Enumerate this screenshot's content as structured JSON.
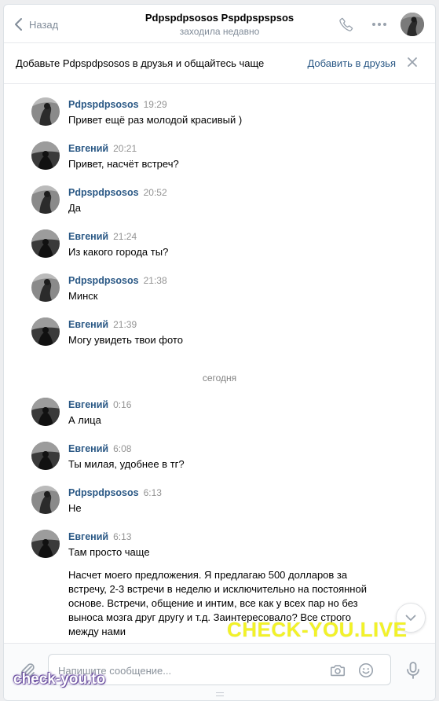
{
  "header": {
    "back_label": "Назад",
    "title": "Pdpspdpsosos Pspdpspspsos",
    "status": "заходила недавно"
  },
  "banner": {
    "text": "Добавьте Pdpspdpsosos в друзья и общайтесь чаще",
    "add_label": "Добавить в друзья"
  },
  "messages": [
    {
      "author": "Pdpspdpsosos",
      "time": "19:29",
      "text": "Привет ещё раз молодой красивый )"
    },
    {
      "author": "Евгений",
      "time": "20:21",
      "text": "Привет, насчёт встреч?"
    },
    {
      "author": "Pdpspdpsosos",
      "time": "20:52",
      "text": "Да"
    },
    {
      "author": "Евгений",
      "time": "21:24",
      "text": "Из какого города ты?"
    },
    {
      "author": "Pdpspdpsosos",
      "time": "21:38",
      "text": "Минск"
    },
    {
      "author": "Евгений",
      "time": "21:39",
      "text": "Могу увидеть твои фото"
    },
    {
      "author": "Евгений",
      "time": "0:16",
      "text": "А лица"
    },
    {
      "author": "Евгений",
      "time": "6:08",
      "text": "Ты милая, удобнее в тг?"
    },
    {
      "author": "Pdpspdpsosos",
      "time": "6:13",
      "text": "Не"
    },
    {
      "author": "Евгений",
      "time": "6:13",
      "text": "Там просто чаще",
      "extra": "Насчет моего предложения. Я предлагаю 500 долларов за встречу, 2-3 встречи в неделю и исключительно на постоянной основе. Встречи, общение и интим, все как у всех пар но без выноса мозга друг другу и т.д. Заинтересовало? Все строго между нами"
    }
  ],
  "date_separator": "сегодня",
  "composer": {
    "placeholder": "Напишите сообщение..."
  },
  "watermarks": {
    "main": "CHECK-YOU.LIVE",
    "corner": "check-you.to"
  },
  "colors": {
    "accent": "#2a5885",
    "watermark": "#f2f228"
  }
}
